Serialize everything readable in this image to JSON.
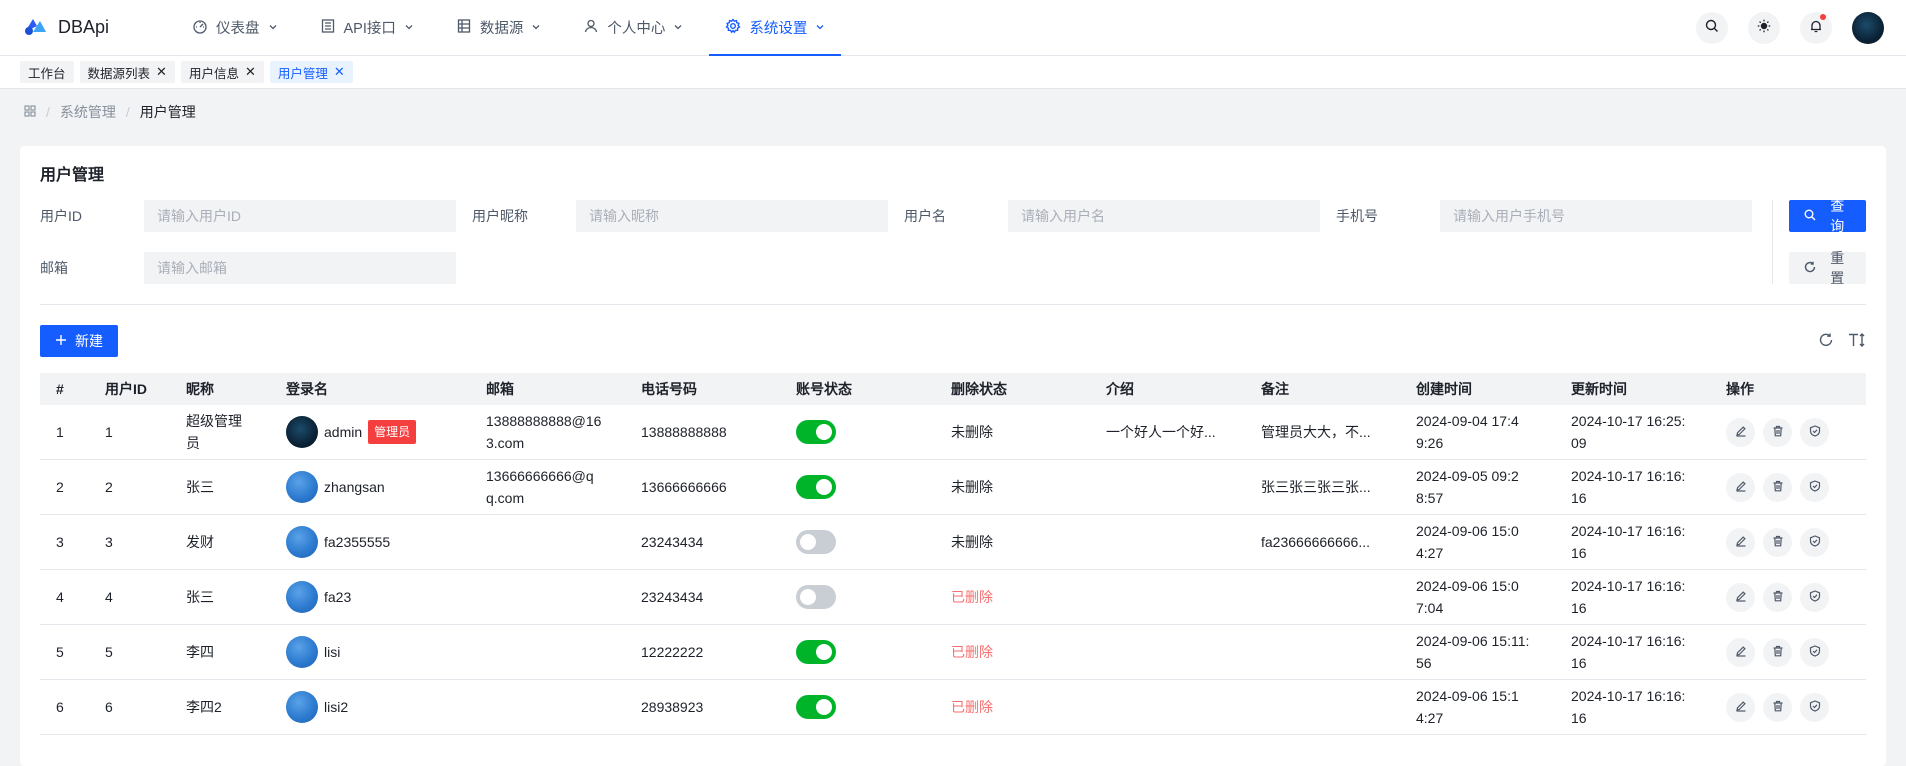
{
  "app": {
    "name": "DBApi"
  },
  "nav": [
    {
      "label": "仪表盘",
      "icon": "dashboard-icon"
    },
    {
      "label": "API接口",
      "icon": "api-doc-icon"
    },
    {
      "label": "数据源",
      "icon": "datasource-icon"
    },
    {
      "label": "个人中心",
      "icon": "user-icon"
    },
    {
      "label": "系统设置",
      "icon": "settings-icon",
      "active": true
    }
  ],
  "tabs": [
    {
      "label": "工作台",
      "closable": false
    },
    {
      "label": "数据源列表",
      "closable": true
    },
    {
      "label": "用户信息",
      "closable": true
    },
    {
      "label": "用户管理",
      "closable": true,
      "active": true
    }
  ],
  "breadcrumb": {
    "parent": "系统管理",
    "current": "用户管理"
  },
  "page": {
    "title": "用户管理"
  },
  "search": {
    "fields": [
      {
        "label": "用户ID",
        "placeholder": "请输入用户ID",
        "value": ""
      },
      {
        "label": "用户昵称",
        "placeholder": "请输入昵称",
        "value": ""
      },
      {
        "label": "用户名",
        "placeholder": "请输入用户名",
        "value": ""
      },
      {
        "label": "手机号",
        "placeholder": "请输入用户手机号",
        "value": ""
      },
      {
        "label": "邮箱",
        "placeholder": "请输入邮箱",
        "value": ""
      }
    ],
    "query_label": "查询",
    "reset_label": "重置"
  },
  "toolbar": {
    "new_label": "新建"
  },
  "table": {
    "headers": [
      "#",
      "用户ID",
      "昵称",
      "登录名",
      "邮箱",
      "电话号码",
      "账号状态",
      "删除状态",
      "介绍",
      "备注",
      "创建时间",
      "更新时间",
      "操作"
    ],
    "rows": [
      {
        "idx": "1",
        "uid": "1",
        "nick": "超级管理\n员",
        "login": "admin",
        "badge": "管理员",
        "email": "13888888888@16\n3.com",
        "phone": "13888888888",
        "enabled": true,
        "del": "未删除",
        "deleted": false,
        "intro": "一个好人一个好...",
        "remark": "管理员大大，不...",
        "created": "2024-09-04 17:4\n9:26",
        "updated": "2024-10-17 16:25:\n09"
      },
      {
        "idx": "2",
        "uid": "2",
        "nick": "张三",
        "login": "zhangsan",
        "badge": "",
        "email": "13666666666@q\nq.com",
        "phone": "13666666666",
        "enabled": true,
        "del": "未删除",
        "deleted": false,
        "intro": "",
        "remark": "张三张三张三张...",
        "created": "2024-09-05 09:2\n8:57",
        "updated": "2024-10-17 16:16:\n16"
      },
      {
        "idx": "3",
        "uid": "3",
        "nick": "发财",
        "login": "fa2355555",
        "badge": "",
        "email": "",
        "phone": "23243434",
        "enabled": false,
        "del": "未删除",
        "deleted": false,
        "intro": "",
        "remark": "fa23666666666...",
        "created": "2024-09-06 15:0\n4:27",
        "updated": "2024-10-17 16:16:\n16"
      },
      {
        "idx": "4",
        "uid": "4",
        "nick": "张三",
        "login": "fa23",
        "badge": "",
        "email": "",
        "phone": "23243434",
        "enabled": false,
        "del": "已删除",
        "deleted": true,
        "intro": "",
        "remark": "",
        "created": "2024-09-06 15:0\n7:04",
        "updated": "2024-10-17 16:16:\n16"
      },
      {
        "idx": "5",
        "uid": "5",
        "nick": "李四",
        "login": "lisi",
        "badge": "",
        "email": "",
        "phone": "12222222",
        "enabled": true,
        "del": "已删除",
        "deleted": true,
        "intro": "",
        "remark": "",
        "created": "2024-09-06 15:11:\n56",
        "updated": "2024-10-17 16:16:\n16"
      },
      {
        "idx": "6",
        "uid": "6",
        "nick": "李四2",
        "login": "lisi2",
        "badge": "",
        "email": "",
        "phone": "28938923",
        "enabled": true,
        "del": "已删除",
        "deleted": true,
        "intro": "",
        "remark": "",
        "created": "2024-09-06 15:1\n4:27",
        "updated": "2024-10-17 16:16:\n16"
      }
    ]
  },
  "colors": {
    "primary": "#165dff",
    "success": "#00b42a",
    "danger": "#f53f3f"
  }
}
